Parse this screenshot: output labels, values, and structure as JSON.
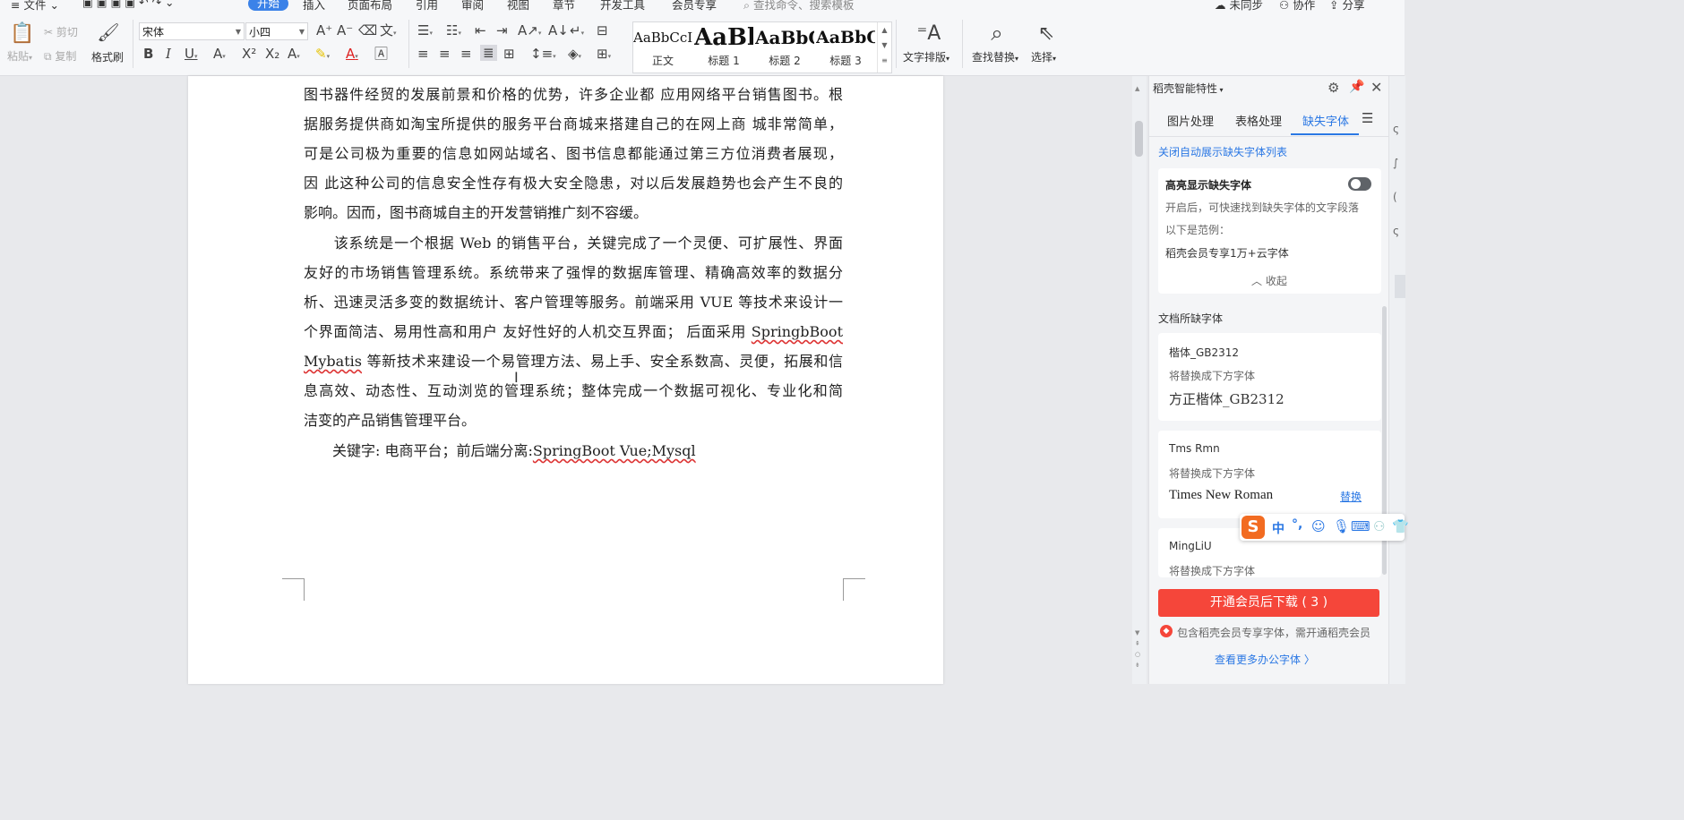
{
  "menubar": {
    "file": "文件",
    "tabs": [
      "开始",
      "插入",
      "页面布局",
      "引用",
      "审阅",
      "视图",
      "章节",
      "开发工具",
      "会员专享"
    ],
    "search_placeholder": "查找命令、搜索模板",
    "sync": "未同步",
    "collab": "协作",
    "share": "分享"
  },
  "ribbon": {
    "paste": "粘贴",
    "cut": "剪切",
    "copy": "复制",
    "format_painter": "格式刷",
    "font_name": "宋体",
    "font_size": "小四",
    "styles": [
      {
        "preview": "AaBbCcI",
        "name": "正文"
      },
      {
        "preview": "AaBl",
        "name": "标题 1"
      },
      {
        "preview": "AaBbC",
        "name": "标题 2"
      },
      {
        "preview": "AaBbC",
        "name": "标题 3"
      }
    ],
    "text_layout": "文字排版",
    "find_replace": "查找替换",
    "select": "选择"
  },
  "document": {
    "para1": [
      "图书器件经贸的发展前景和价格的优势，许多企业都 应用网络平台销售图书。根",
      "据服务提供商如淘宝所提供的服务平台商城来搭建自己的在网上商  城非常简单，",
      "可是公司极为重要的信息如网站域名、图书信息都能通过第三方位消费者展现，",
      "因  此这种公司的信息安全性存有极大安全隐患，对以后发展趋势也会产生不良的",
      "影响。因而，图书商城自主的开发营销推广刻不容缓。"
    ],
    "para2": [
      "　　该系统是一个根据 Web 的销售平台，关键完成了一个灵便、可扩展性、界面",
      "友好的市场销售管理系统。系统带来了强悍的数据库管理、精确高效率的数据分",
      "析、迅速灵活多变的数据统计、客户管理等服务。前端采用  VUE 等技术来设计一",
      "个界面简洁、易用性高和用户  友好性好的人机交互界面；  后面采用 ",
      "SpringbBoot",
      " 等新技术来建设一个易管理方法、易上手、安全系数高、灵便，拓展和信",
      "Mybatis",
      "息高效、动态性、互动浏览的管理系统；整体完成一个数据可视化、专业化和简",
      "洁变的产品销售管理平台。"
    ],
    "keywords_prefix": "　　关键字:  电商平台；前后端分离:",
    "keywords_terms": "SpringBoot Vue;Mysql"
  },
  "panel": {
    "title": "稻壳智能特性",
    "tabs": [
      "图片处理",
      "表格处理",
      "缺失字体"
    ],
    "close_auto_link": "关闭自动展示缺失字体列表",
    "highlight_title": "高亮显示缺失字体",
    "highlight_desc": "开启后，可快速找到缺失字体的文字段落",
    "example_label": "以下是范例：",
    "example_text": "稻壳会员专享1万+云字体",
    "collapse": "收起",
    "section_title": "文档所缺字体",
    "fonts": [
      {
        "missing": "楷体_GB2312",
        "hint": "将替换成下方字体",
        "replacement": "方正楷体_GB2312",
        "action": ""
      },
      {
        "missing": "Tms Rmn",
        "hint": "将替换成下方字体",
        "replacement": "Times New Roman",
        "action": "替换"
      },
      {
        "missing": "MingLiU",
        "hint": "将替换成下方字体",
        "replacement": "",
        "action": ""
      }
    ],
    "buy_button": "开通会员后下载 ( 3 )",
    "notice": "包含稻壳会员专享字体，需开通稻壳会员",
    "more_fonts": "查看更多办公字体 〉"
  },
  "ime": {
    "lang": "中",
    "punct": "°,"
  },
  "colors": {
    "accent": "#2b78e4",
    "buy_button": "#f5463a",
    "link": "#2b78e4"
  }
}
